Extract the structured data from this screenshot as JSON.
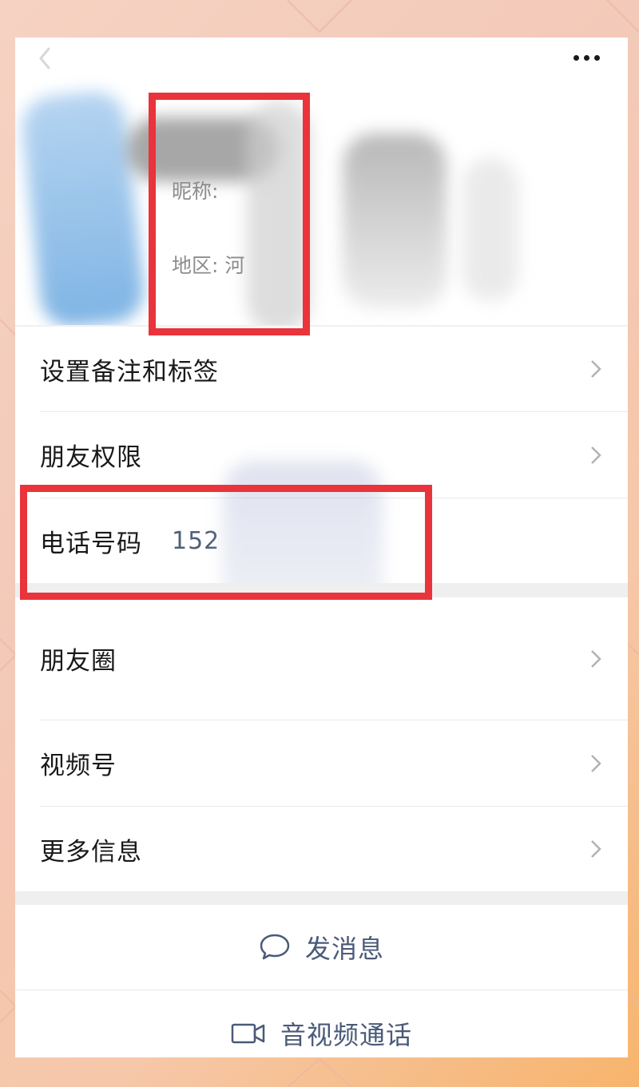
{
  "header": {
    "nickname_text": "昵称: ",
    "region_text": "地区: 河"
  },
  "menu": {
    "remark_tags": "设置备注和标签",
    "friend_permissions": "朋友权限",
    "phone_label": "电话号码",
    "phone_value": "152",
    "moments": "朋友圈",
    "channels": "视频号",
    "more_info": "更多信息"
  },
  "actions": {
    "send_message": "发消息",
    "av_call": "音视频通话"
  },
  "colors": {
    "highlight": "#e8343a",
    "action_text": "#4a5a78"
  }
}
